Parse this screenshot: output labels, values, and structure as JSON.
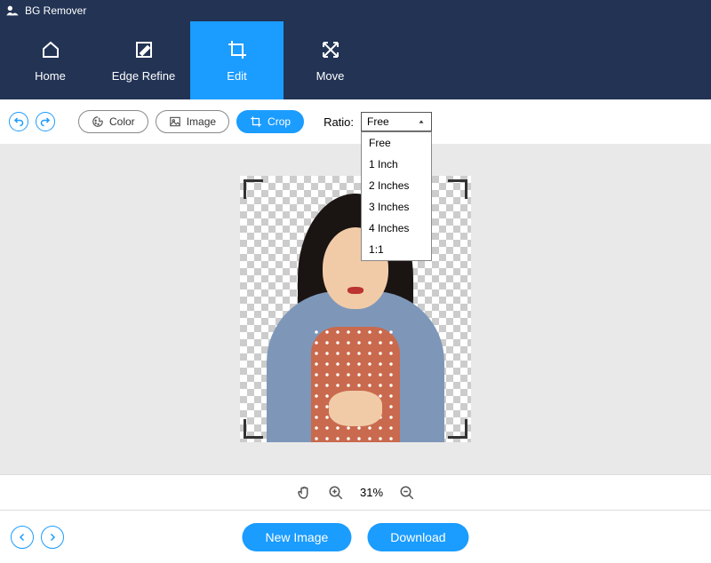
{
  "app": {
    "title": "BG Remover"
  },
  "nav": [
    {
      "label": "Home"
    },
    {
      "label": "Edge Refine"
    },
    {
      "label": "Edit",
      "active": true
    },
    {
      "label": "Move"
    }
  ],
  "toolbar": {
    "color_label": "Color",
    "image_label": "Image",
    "crop_label": "Crop",
    "ratio_label": "Ratio:",
    "ratio_selected": "Free",
    "ratio_options": [
      "Free",
      "1 Inch",
      "2 Inches",
      "3 Inches",
      "4 Inches",
      "1:1"
    ]
  },
  "zoom": {
    "percent": "31%"
  },
  "bottom": {
    "new_image": "New Image",
    "download": "Download"
  }
}
